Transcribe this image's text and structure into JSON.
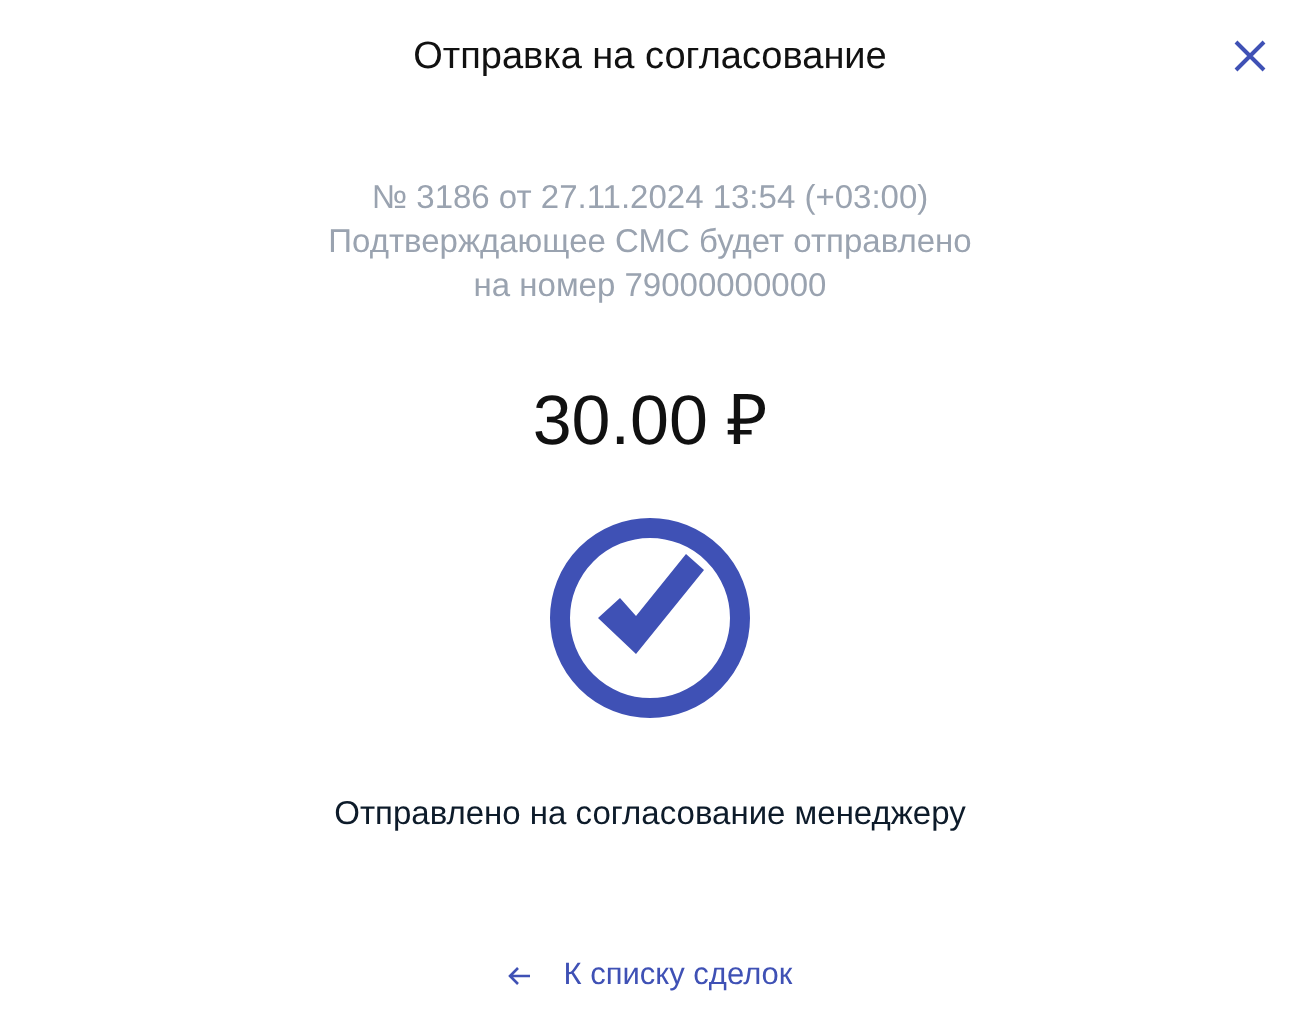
{
  "dialog": {
    "title": "Отправка на согласование"
  },
  "info": [
    "№ 3186 от 27.11.2024 13:54 (+03:00)",
    "Подтверждающее СМС будет отправлено",
    "на номер 79000000000"
  ],
  "amount": "30.00 ₽",
  "status": {
    "kind": "success",
    "message": "Отправлено на согласование менеджеру"
  },
  "back_link": {
    "label": "К списку сделок"
  }
}
